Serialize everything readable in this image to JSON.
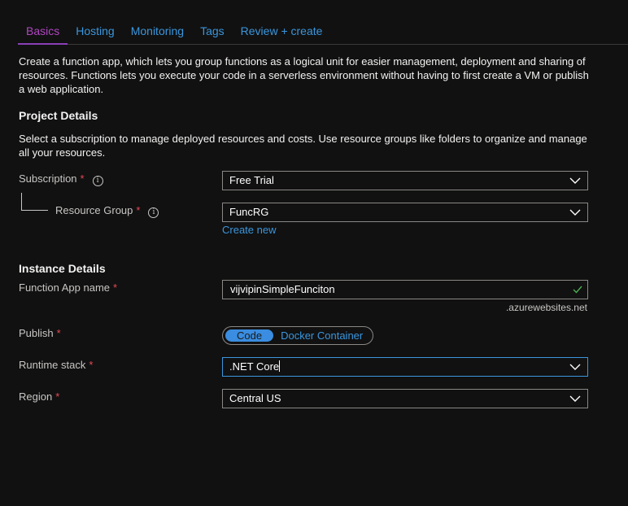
{
  "tabs": [
    {
      "label": "Basics",
      "active": true
    },
    {
      "label": "Hosting",
      "active": false
    },
    {
      "label": "Monitoring",
      "active": false
    },
    {
      "label": "Tags",
      "active": false
    },
    {
      "label": "Review + create",
      "active": false
    }
  ],
  "intro": "Create a function app, which lets you group functions as a logical unit for easier management, deployment and sharing of resources. Functions lets you execute your code in a serverless environment without having to first create a VM or publish a web application.",
  "project_details": {
    "heading": "Project Details",
    "description": "Select a subscription to manage deployed resources and costs. Use resource groups like folders to organize and manage all your resources.",
    "subscription": {
      "label": "Subscription",
      "required": "*",
      "value": "Free Trial"
    },
    "resource_group": {
      "label": "Resource Group",
      "required": "*",
      "value": "FuncRG",
      "create_new_label": "Create new"
    }
  },
  "instance_details": {
    "heading": "Instance Details",
    "function_app_name": {
      "label": "Function App name",
      "required": "*",
      "value": "vijvipinSimpleFunciton",
      "suffix": ".azurewebsites.net"
    },
    "publish": {
      "label": "Publish",
      "required": "*",
      "options": [
        "Code",
        "Docker Container"
      ],
      "selected": "Code"
    },
    "runtime_stack": {
      "label": "Runtime stack",
      "required": "*",
      "value": ".NET Core"
    },
    "region": {
      "label": "Region",
      "required": "*",
      "value": "Central US"
    }
  },
  "colors": {
    "background": "#111111",
    "link": "#3a96dd",
    "active_tab": "#b146c2",
    "required": "#e74856",
    "valid_check": "#4caf50",
    "toggle_selected": "#3a8de0"
  },
  "icons": {
    "info": "info-icon",
    "dropdown": "chevron-down-icon",
    "valid": "checkmark-icon"
  }
}
